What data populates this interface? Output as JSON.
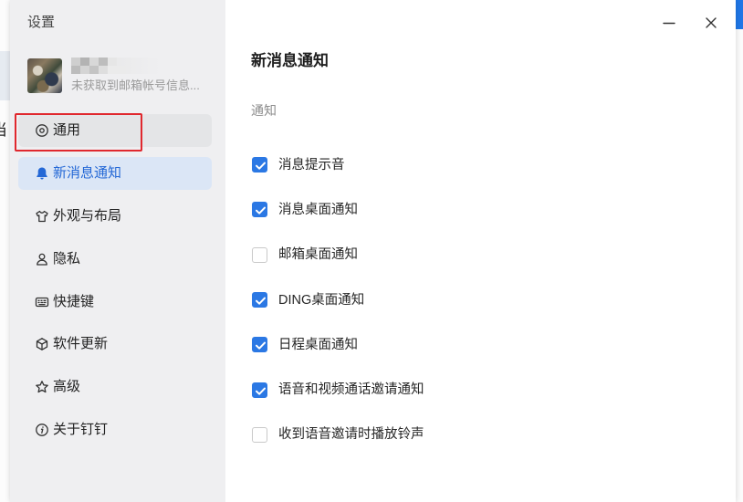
{
  "window": {
    "title": "设置",
    "controls": {
      "minimize_icon": "minimize-icon",
      "close_icon": "close-icon"
    }
  },
  "background": {
    "left_fragment": "当"
  },
  "profile": {
    "avatar_icon": "avatar",
    "email_status": "未获取到邮箱帐号信息..."
  },
  "sidebar": {
    "items": [
      {
        "label": "通用",
        "icon": "settings-icon",
        "state": "hover",
        "outlined": true
      },
      {
        "label": "新消息通知",
        "icon": "bell-icon",
        "state": "selected"
      },
      {
        "label": "外观与布局",
        "icon": "shirt-icon",
        "state": "normal"
      },
      {
        "label": "隐私",
        "icon": "user-icon",
        "state": "normal"
      },
      {
        "label": "快捷键",
        "icon": "keyboard-icon",
        "state": "normal"
      },
      {
        "label": "软件更新",
        "icon": "cube-icon",
        "state": "normal"
      },
      {
        "label": "高级",
        "icon": "star-icon",
        "state": "normal"
      },
      {
        "label": "关于钉钉",
        "icon": "info-icon",
        "state": "normal"
      }
    ]
  },
  "main": {
    "title": "新消息通知",
    "section_title": "通知",
    "options": [
      {
        "label": "消息提示音",
        "checked": true
      },
      {
        "label": "消息桌面通知",
        "checked": true
      },
      {
        "label": "邮箱桌面通知",
        "checked": false
      },
      {
        "label": "DING桌面通知",
        "checked": true
      },
      {
        "label": "日程桌面通知",
        "checked": true
      },
      {
        "label": "语音和视频通话邀请通知",
        "checked": true
      },
      {
        "label": "收到语音邀请时播放铃声",
        "checked": false
      }
    ]
  },
  "colors": {
    "accent": "#2b78e4",
    "selected_bg": "#dbe6f6",
    "selected_text": "#2468d6",
    "hover_bg": "#e4e5e7",
    "sidebar_bg": "#efeff1",
    "annotation": "#e0282e"
  }
}
